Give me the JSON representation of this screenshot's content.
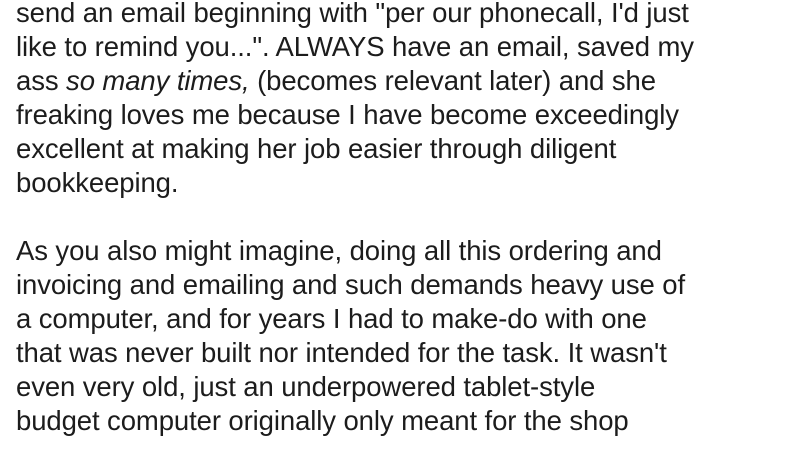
{
  "post": {
    "paragraphs": [
      {
        "lines": [
          "send an email beginning with \"per our phonecall, I'd just",
          "like to remind you...\". ALWAYS have an email, saved my",
          {
            "before": "ass ",
            "emphasis": "so many times,",
            "after": " (becomes relevant later) and she"
          },
          "freaking loves me because I have become exceedingly",
          "excellent at making her job easier through diligent",
          "bookkeeping."
        ]
      },
      {
        "lines": [
          "As you also might imagine, doing all this ordering and",
          "invoicing and emailing and such demands heavy use of",
          "a computer, and for years I had to make-do with one",
          "that was never built nor intended for the task. It wasn't",
          "even very old, just an underpowered tablet-style",
          "budget computer originally only meant for the shop"
        ]
      }
    ]
  }
}
